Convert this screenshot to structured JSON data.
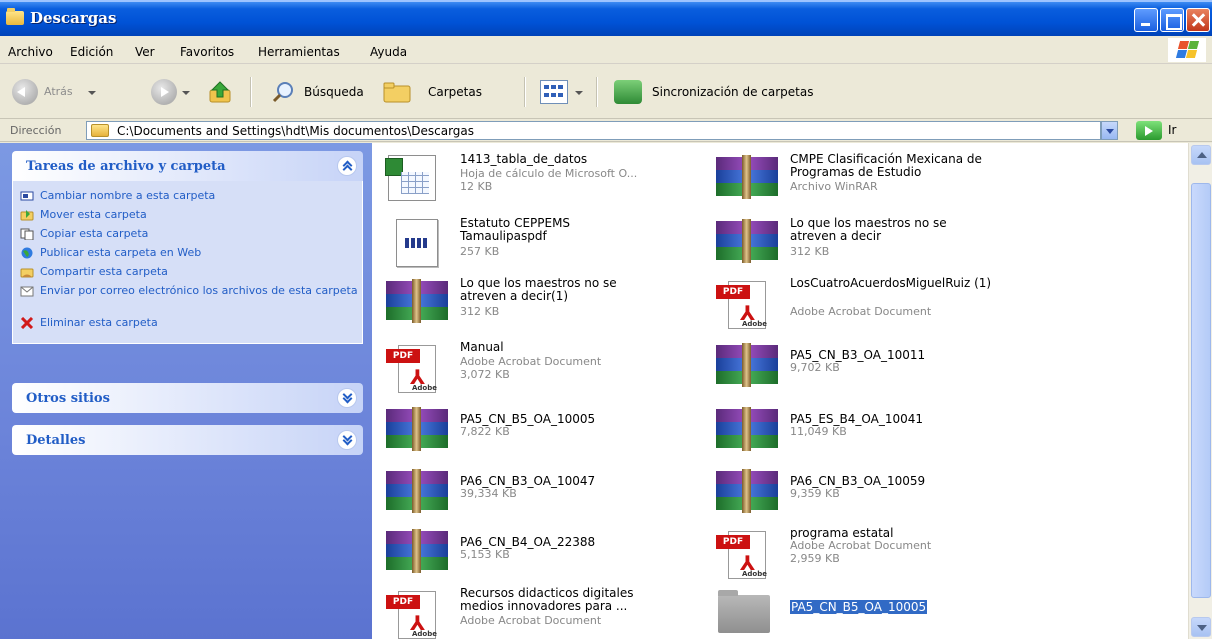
{
  "window": {
    "title": "Descargas"
  },
  "menu": [
    "Archivo",
    "Edición",
    "Ver",
    "Favoritos",
    "Herramientas",
    "Ayuda"
  ],
  "toolbar": {
    "back_label": "Atrás",
    "search_label": "Búsqueda",
    "folders_label": "Carpetas",
    "sync_label": "Sincronización de carpetas"
  },
  "address": {
    "label": "Dirección",
    "path": "C:\\Documents and Settings\\hdt\\Mis documentos\\Descargas",
    "go_label": "Ir"
  },
  "sidebar": {
    "tasks_title": "Tareas de archivo y carpeta",
    "tasks": [
      "Cambiar nombre a esta carpeta",
      "Mover esta carpeta",
      "Copiar esta carpeta",
      "Publicar esta carpeta en Web",
      "Compartir esta carpeta",
      "Enviar por correo electrónico los archivos de esta carpeta",
      "Eliminar esta carpeta"
    ],
    "other_title": "Otros sitios",
    "details_title": "Detalles"
  },
  "files": [
    {
      "name": "1413_tabla_de_datos",
      "type": "Hoja de cálculo de Microsoft O...",
      "size": "12 KB",
      "icon": "excel-icon"
    },
    {
      "name": "CMPE Clasificación Mexicana de Programas de Estudio",
      "type": "Archivo WinRAR",
      "size": "",
      "icon": "winrar-icon"
    },
    {
      "name": "Estatuto CEPPEMS Tamaulipaspdf",
      "type": "",
      "size": "257 KB",
      "icon": "document-icon"
    },
    {
      "name": "Lo que los maestros no se atreven a decir",
      "type": "",
      "size": "312 KB",
      "icon": "winrar-icon"
    },
    {
      "name": "Lo que los maestros no se atreven a decir(1)",
      "type": "",
      "size": "312 KB",
      "icon": "winrar-icon"
    },
    {
      "name": "LosCuatroAcuerdosMiguelRuiz (1)",
      "type": "Adobe Acrobat Document",
      "size": "",
      "icon": "pdf-icon"
    },
    {
      "name": "Manual",
      "type": "Adobe Acrobat Document",
      "size": "3,072 KB",
      "icon": "pdf-icon"
    },
    {
      "name": "PA5_CN_B3_OA_10011",
      "type": "",
      "size": "9,702 KB",
      "icon": "winrar-icon"
    },
    {
      "name": "PA5_CN_B5_OA_10005",
      "type": "",
      "size": "7,822 KB",
      "icon": "winrar-icon"
    },
    {
      "name": "PA5_ES_B4_OA_10041",
      "type": "",
      "size": "11,049 KB",
      "icon": "winrar-icon"
    },
    {
      "name": "PA6_CN_B3_OA_10047",
      "type": "",
      "size": "39,334 KB",
      "icon": "winrar-icon"
    },
    {
      "name": "PA6_CN_B3_OA_10059",
      "type": "",
      "size": "9,359 KB",
      "icon": "winrar-icon"
    },
    {
      "name": "PA6_CN_B4_OA_22388",
      "type": "",
      "size": "5,153 KB",
      "icon": "winrar-icon"
    },
    {
      "name": "programa estatal",
      "type": "Adobe Acrobat Document",
      "size": "2,959 KB",
      "icon": "pdf-icon"
    },
    {
      "name": "Recursos didacticos digitales medios innovadores para ...",
      "type": "Adobe Acrobat Document",
      "size": "",
      "icon": "pdf-icon"
    },
    {
      "name": "PA5_CN_B5_OA_10005",
      "type": "",
      "size": "",
      "icon": "folder-icon",
      "selected": true
    }
  ],
  "colors": {
    "titlebar": "#0052d6",
    "sidebar": "#7c99e3",
    "selection": "#316ac5",
    "link": "#215dc6"
  }
}
